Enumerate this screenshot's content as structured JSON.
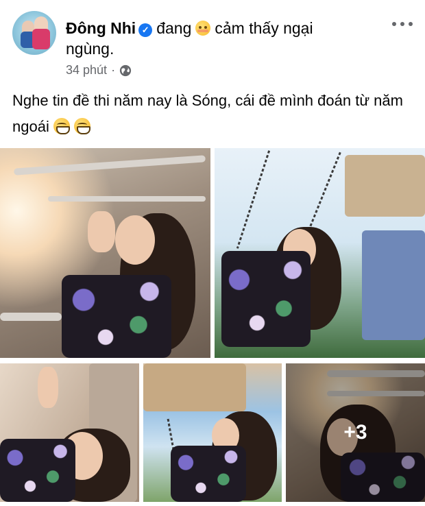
{
  "post": {
    "author": "Đông Nhi",
    "feeling_prefix": "đang",
    "feeling_text": "cảm thấy ngại ngùng.",
    "time": "34 phút",
    "separator": "·",
    "audience_icon": "globe-icon",
    "text": "Nghe tin đề thi năm nay là Sóng, cái đề mình đoán từ năm ngoái",
    "more_icon": "more-horizontal-icon"
  },
  "photos": {
    "more_count": "+3"
  },
  "colors": {
    "verified": "#1877f2",
    "meta_text": "#65676b"
  }
}
